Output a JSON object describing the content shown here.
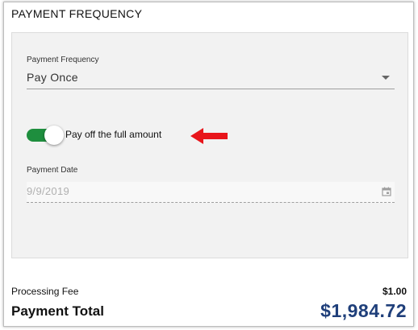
{
  "section": {
    "title": "PAYMENT FREQUENCY"
  },
  "frequency": {
    "label": "Payment Frequency",
    "value": "Pay Once"
  },
  "payoff_toggle": {
    "label": "Pay off the full amount",
    "on": true,
    "color": "#1e8e3e"
  },
  "annotation": {
    "arrow_color": "#e8151b"
  },
  "payment_date": {
    "label": "Payment Date",
    "value": "9/9/2019"
  },
  "summary": {
    "fee_label": "Processing Fee",
    "fee_value": "$1.00",
    "total_label": "Payment Total",
    "total_value": "$1,984.72",
    "total_color": "#1f3f7a"
  }
}
